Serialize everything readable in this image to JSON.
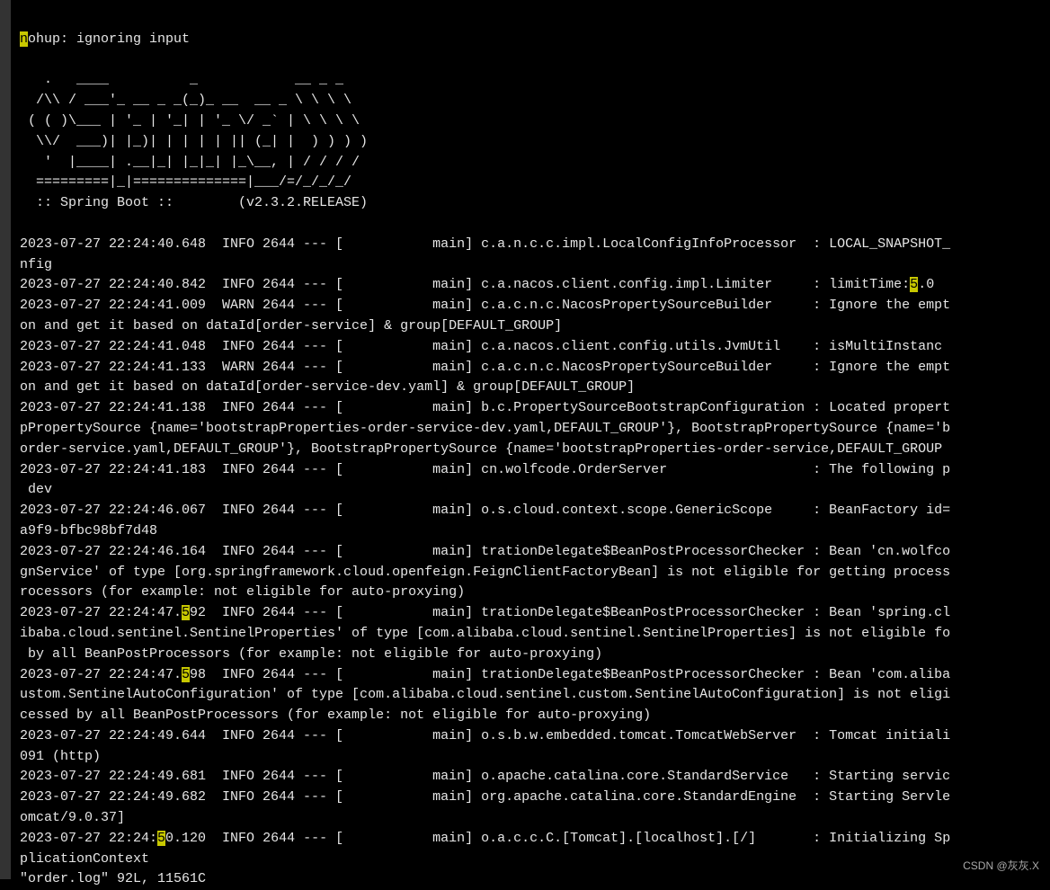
{
  "nohup_line": "nohup: ignoring input",
  "cursor_hl": "n",
  "banner": [
    "   .   ____          _            __ _ _",
    "  /\\\\ / ___'_ __ _ _(_)_ __  __ _ \\ \\ \\ \\",
    " ( ( )\\___ | '_ | '_| | '_ \\/ _` | \\ \\ \\ \\",
    "  \\\\/  ___)| |_)| | | | | || (_| |  ) ) ) )",
    "   '  |____| .__|_| |_|_| |_\\__, | / / / /",
    "  =========|_|==============|___/=/_/_/_/",
    "  :: Spring Boot ::        (v2.3.2.RELEASE)"
  ],
  "hl_5a": "5",
  "hl_5b": "5",
  "hl_5c": "5",
  "hl_5d": "5",
  "log_01": "2023-07-27 22:24:40.648  INFO 2644 --- [           main] c.a.n.c.c.impl.LocalConfigInfoProcessor  : LOCAL_SNAPSHOT_",
  "log_01b": "nfig",
  "log_02a": "2023-07-27 22:24:40.842  INFO 2644 --- [           main] c.a.nacos.client.config.impl.Limiter     : limitTime:",
  "log_02b": ".0",
  "log_03": "2023-07-27 22:24:41.009  WARN 2644 --- [           main] c.a.c.n.c.NacosPropertySourceBuilder     : Ignore the empt",
  "log_03b": "on and get it based on dataId[order-service] & group[DEFAULT_GROUP]",
  "log_04": "2023-07-27 22:24:41.048  INFO 2644 --- [           main] c.a.nacos.client.config.utils.JvmUtil    : isMultiInstanc",
  "log_05": "2023-07-27 22:24:41.133  WARN 2644 --- [           main] c.a.c.n.c.NacosPropertySourceBuilder     : Ignore the empt",
  "log_05b": "on and get it based on dataId[order-service-dev.yaml] & group[DEFAULT_GROUP]",
  "log_06": "2023-07-27 22:24:41.138  INFO 2644 --- [           main] b.c.PropertySourceBootstrapConfiguration : Located propert",
  "log_06b": "pPropertySource {name='bootstrapProperties-order-service-dev.yaml,DEFAULT_GROUP'}, BootstrapPropertySource {name='b",
  "log_06c": "order-service.yaml,DEFAULT_GROUP'}, BootstrapPropertySource {name='bootstrapProperties-order-service,DEFAULT_GROUP",
  "log_07": "2023-07-27 22:24:41.183  INFO 2644 --- [           main] cn.wolfcode.OrderServer                  : The following p",
  "log_07b": " dev",
  "log_08": "2023-07-27 22:24:46.067  INFO 2644 --- [           main] o.s.cloud.context.scope.GenericScope     : BeanFactory id=",
  "log_08b": "a9f9-bfbc98bf7d48",
  "log_09": "2023-07-27 22:24:46.164  INFO 2644 --- [           main] trationDelegate$BeanPostProcessorChecker : Bean 'cn.wolfco",
  "log_09b": "gnService' of type [org.springframework.cloud.openfeign.FeignClientFactoryBean] is not eligible for getting process",
  "log_09c": "rocessors (for example: not eligible for auto-proxying)",
  "log_10a": "2023-07-27 22:24:47.",
  "log_10b": "92  INFO 2644 --- [           main] trationDelegate$BeanPostProcessorChecker : Bean 'spring.cl",
  "log_10c": "ibaba.cloud.sentinel.SentinelProperties' of type [com.alibaba.cloud.sentinel.SentinelProperties] is not eligible fo",
  "log_10d": " by all BeanPostProcessors (for example: not eligible for auto-proxying)",
  "log_11a": "2023-07-27 22:24:47.",
  "log_11b": "98  INFO 2644 --- [           main] trationDelegate$BeanPostProcessorChecker : Bean 'com.aliba",
  "log_11c": "ustom.SentinelAutoConfiguration' of type [com.alibaba.cloud.sentinel.custom.SentinelAutoConfiguration] is not eligi",
  "log_11d": "cessed by all BeanPostProcessors (for example: not eligible for auto-proxying)",
  "log_12": "2023-07-27 22:24:49.644  INFO 2644 --- [           main] o.s.b.w.embedded.tomcat.TomcatWebServer  : Tomcat initiali",
  "log_12b": "091 (http)",
  "log_13": "2023-07-27 22:24:49.681  INFO 2644 --- [           main] o.apache.catalina.core.StandardService   : Starting servic",
  "log_14": "2023-07-27 22:24:49.682  INFO 2644 --- [           main] org.apache.catalina.core.StandardEngine  : Starting Servle",
  "log_14b": "omcat/9.0.37]",
  "log_15a": "2023-07-27 22:24:",
  "log_15b": "0.120  INFO 2644 --- [           main] o.a.c.c.C.[Tomcat].[localhost].[/]       : Initializing Sp",
  "log_15c": "plicationContext",
  "status_line": "\"order.log\" 92L, 11561C",
  "watermark": "CSDN @灰灰.X"
}
